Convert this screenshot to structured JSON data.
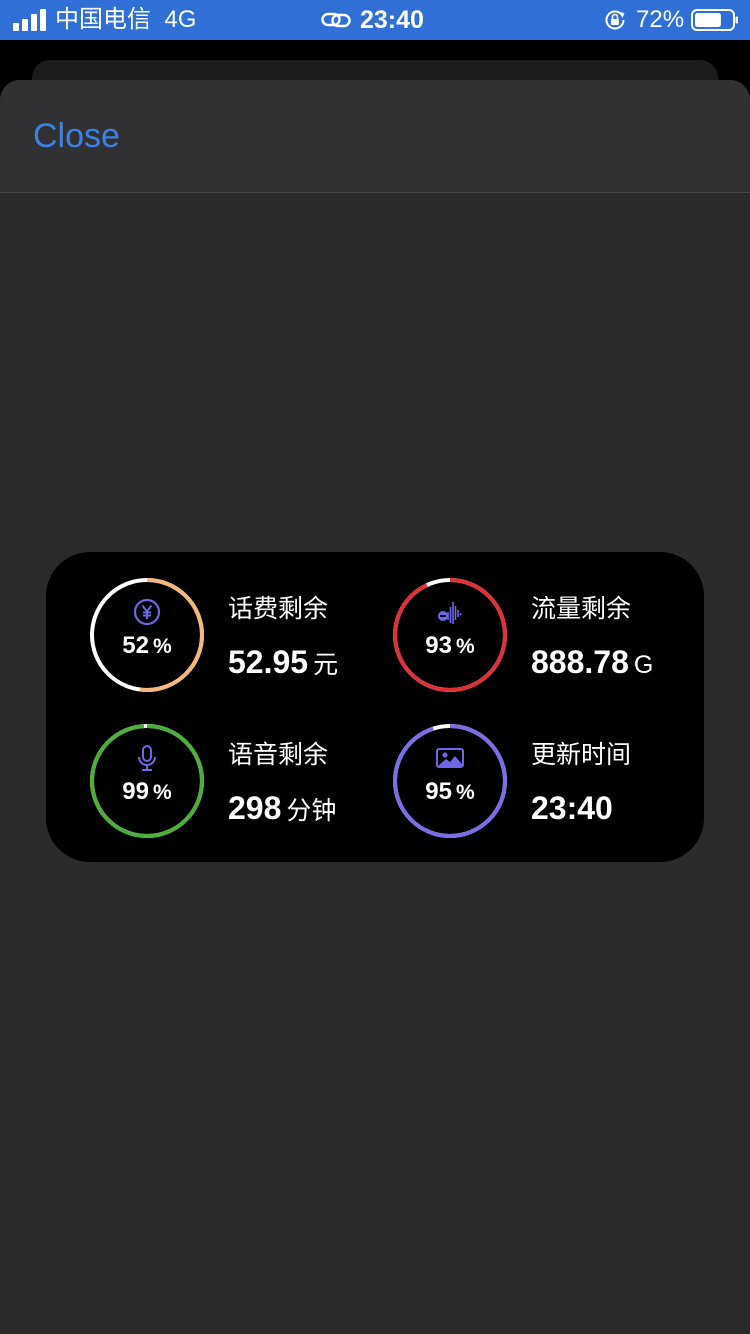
{
  "status_bar": {
    "carrier": "中国电信",
    "network": "4G",
    "time": "23:40",
    "battery": "72%",
    "battery_level": 0.72
  },
  "sheet": {
    "close_label": "Close"
  },
  "widget": {
    "items": [
      {
        "label": "话费剩余",
        "value": "52.95",
        "unit": "元",
        "percent": "52",
        "percent_unit": "%",
        "percent_value": 52,
        "ring_color": "#f6b77b",
        "rest_color": "#ffffff",
        "icon": "yuan-icon"
      },
      {
        "label": "流量剩余",
        "value": "888.78",
        "unit": "G",
        "percent": "93",
        "percent_unit": "%",
        "percent_value": 93,
        "ring_color": "#e0313a",
        "rest_color": "#ffffff",
        "icon": "waveform-icon"
      },
      {
        "label": "语音剩余",
        "value": "298",
        "unit": "分钟",
        "percent": "99",
        "percent_unit": "%",
        "percent_value": 99,
        "ring_color": "#4caf39",
        "rest_color": "#ffffff",
        "icon": "microphone-icon"
      },
      {
        "label": "更新时间",
        "value": "23:40",
        "unit": "",
        "percent": "95",
        "percent_unit": "%",
        "percent_value": 95,
        "ring_color": "#7a6ee8",
        "rest_color": "#ffffff",
        "icon": "image-icon"
      }
    ],
    "icon_color": "#6e67e6"
  }
}
